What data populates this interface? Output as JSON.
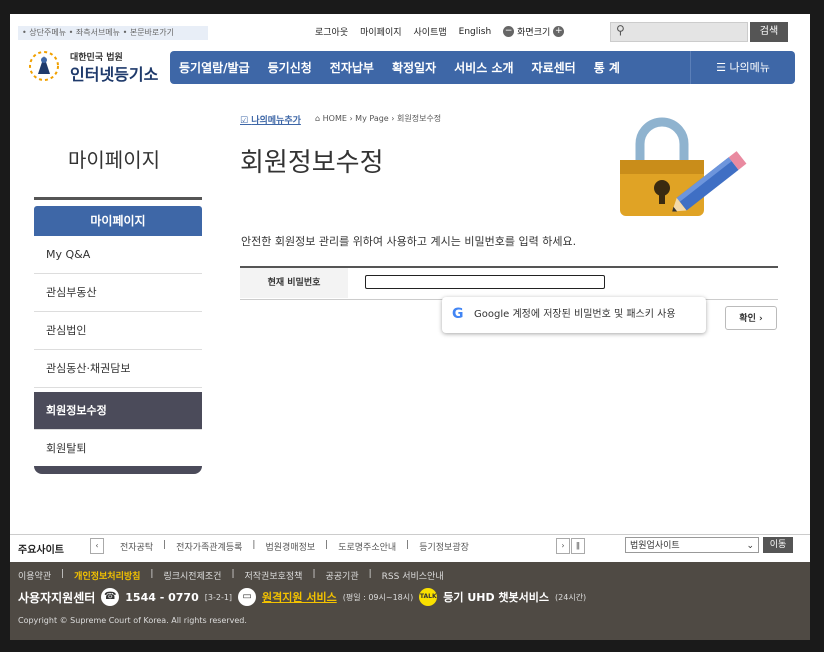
{
  "skip_nav": "• 상단주메뉴 • 좌측서브메뉴 • 본문바로가기",
  "util": {
    "logout": "로그아웃",
    "mypage": "마이페이지",
    "sitemap": "사이트맵",
    "english": "English",
    "zoom_label": "화면크기"
  },
  "search": {
    "button": "검색"
  },
  "logo": {
    "top": "대한민국 법원",
    "main": "인터넷등기소"
  },
  "nav": {
    "items": [
      "등기열람/발급",
      "등기신청",
      "전자납부",
      "확정일자",
      "서비스 소개",
      "자료센터",
      "통 계"
    ],
    "my_menu": "나의메뉴"
  },
  "sidebar": {
    "title": "마이페이지",
    "header": "마이페이지",
    "items": [
      "My Q&A",
      "관심부동산",
      "관심법인",
      "관심동산·채권담보",
      "회원정보수정",
      "회원탈퇴"
    ]
  },
  "breadcrumb": {
    "add": "나의메뉴추가",
    "path": "HOME › My Page › 회원정보수정"
  },
  "page": {
    "title": "회원정보수정",
    "description": "안전한 회원정보 관리를 위하여 사용하고 계시는 비밀번호를 입력 하세요.",
    "password_label": "현재 비밀번호",
    "google_suggest": "Google 계정에 저장된 비밀번호 및 패스키 사용",
    "confirm": "확인 ›"
  },
  "sites": {
    "label": "주요사이트",
    "list": [
      "전자공탁",
      "전자가족관계등록",
      "법원경매정보",
      "도로명주소안내",
      "등기정보광장"
    ],
    "select": "법원업사이트",
    "go": "이동"
  },
  "footer": {
    "links": [
      "이용약관",
      "개인정보처리방침",
      "링크시전제조건",
      "저작권보호정책",
      "공공기관",
      "RSS 서비스안내"
    ],
    "support_label": "사용자지원센터",
    "phone": "1544 - 0770",
    "phone_note": "[3-2-1]",
    "remote": "원격지원 서비스",
    "remote_hours": "(평일 : 09시~18시)",
    "chatbot": "등기 UHD 챗봇서비스",
    "chatbot_hours": "(24시간)",
    "copyright": "Copyright © Supreme Court of Korea. All rights reserved."
  },
  "colors": {
    "nav": "#3e67a7",
    "footer": "#4f4a44",
    "active": "#4b4b5a",
    "highlight": "#f3c200"
  }
}
